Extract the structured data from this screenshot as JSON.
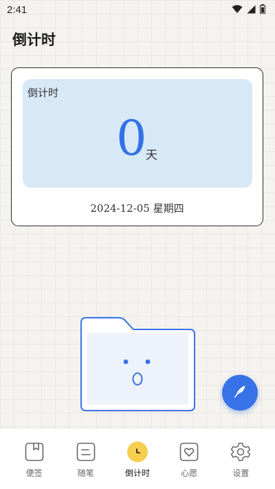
{
  "status_bar": {
    "time": "2:41",
    "icons": [
      "wifi-icon",
      "signal-icon",
      "battery-icon"
    ]
  },
  "header": {
    "title": "倒计时"
  },
  "countdown_card": {
    "label": "倒计时",
    "days": "0",
    "unit": "天",
    "date": "2024-12-05 星期四"
  },
  "empty_state": {
    "icon": "surprised-folder-illustration"
  },
  "fab": {
    "icon": "feather-icon"
  },
  "bottom_nav": {
    "active_index": 2,
    "items": [
      {
        "label": "便签",
        "icon": "notebook-icon"
      },
      {
        "label": "随笔",
        "icon": "note-icon"
      },
      {
        "label": "倒计时",
        "icon": "clock-icon"
      },
      {
        "label": "心愿",
        "icon": "heart-icon"
      },
      {
        "label": "设置",
        "icon": "gear-icon"
      }
    ]
  },
  "colors": {
    "accent": "#3872e8",
    "panel": "#d7e8f6",
    "active_tab": "#f6cf4f"
  }
}
